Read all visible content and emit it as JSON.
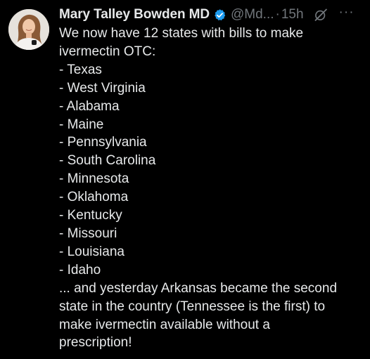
{
  "author": {
    "name": "Mary Talley Bowden MD",
    "handle": "@Md...",
    "separator": "·",
    "time": "15h"
  },
  "icons": {
    "verified": "verified-badge-icon",
    "grok": "grok-icon",
    "more": "more-options-icon",
    "more_glyph": "···"
  },
  "colors": {
    "background": "#000000",
    "text": "#e7e9ea",
    "secondary": "#71767b",
    "verified_blue": "#1d9bf0"
  },
  "tweet": {
    "lines": [
      "We now have 12 states with bills to make",
      "ivermectin OTC:",
      "- Texas",
      "- West Virginia",
      "- Alabama",
      "- Maine",
      "- Pennsylvania",
      "- South Carolina",
      "- Minnesota",
      "- Oklahoma",
      "- Kentucky",
      "- Missouri",
      "- Louisiana",
      "- Idaho",
      "... and yesterday Arkansas became the second",
      "state in the country (Tennessee is the first) to",
      "make ivermectin available without a",
      "prescription!"
    ]
  }
}
